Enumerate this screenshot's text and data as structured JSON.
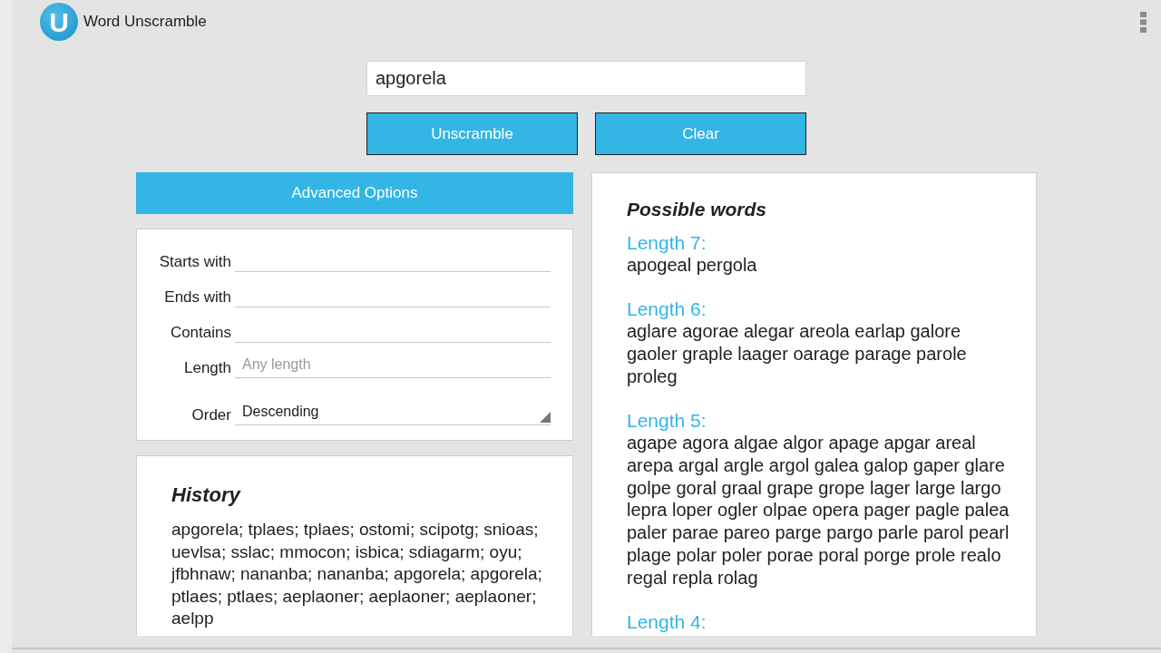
{
  "app_bar": {
    "logo_letter": "U",
    "title": "Word Unscramble"
  },
  "search": {
    "value": "apgorela"
  },
  "buttons": [
    "Unscramble",
    "Clear"
  ],
  "advanced_options": {
    "label": "Advanced Options"
  },
  "options": [
    {
      "kind": "text",
      "label": "Starts with"
    },
    {
      "kind": "text",
      "label": "Ends with"
    },
    {
      "kind": "text",
      "label": "Contains"
    },
    {
      "kind": "text",
      "label": "Length",
      "placeholder": "Any length"
    },
    {
      "kind": "select",
      "label": "Order",
      "value": "Descending"
    }
  ],
  "history": {
    "title": "History",
    "text": "apgorela; tplaes; tplaes; ostomi; scipotg; snioas; uevlsa; sslac; mmocon; isbica; sdiagarm; oyu; jfbhnaw; nananba; nananba; apgorela; apgorela; ptlaes; ptlaes; aeplaoner; aeplaoner; aeplaoner; aelpp"
  },
  "results": {
    "title": "Possible words",
    "groups": [
      {
        "heading": "Length 7:",
        "words": "apogeal pergola"
      },
      {
        "heading": "Length 6:",
        "words": "aglare agorae alegar areola earlap galore gaoler graple laager oarage parage parole proleg"
      },
      {
        "heading": "Length 5:",
        "words": "agape agora algae algor apage apgar areal arepa argal argle argol galea galop gaper glare golpe goral graal grape grope lager large largo lepra loper ogler olpae opera pager pagle palea paler parae pareo parge pargo parle parol pearl plage polar poler porae poral porge prole realo regal repla rolag"
      },
      {
        "heading": "Length 4:"
      }
    ]
  }
}
